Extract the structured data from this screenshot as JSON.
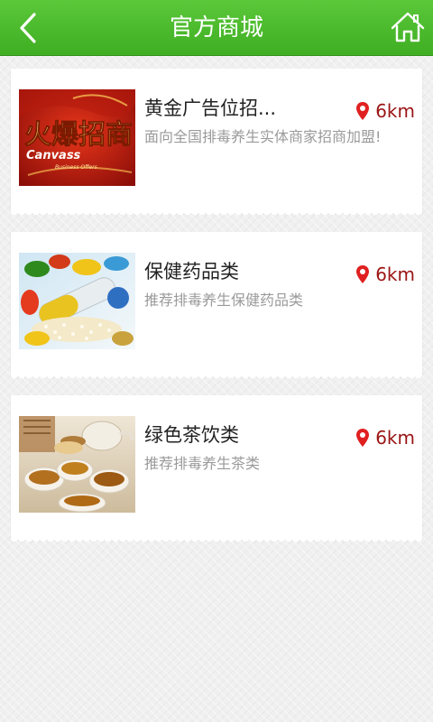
{
  "header": {
    "title": "官方商城",
    "back_icon": "chevron-left-icon",
    "home_icon": "home-icon"
  },
  "colors": {
    "header_green": "#43b02a",
    "distance_red": "#9b1414",
    "pin_red": "#e02020"
  },
  "items": [
    {
      "name": "黄金广告位招...",
      "description": "面向全国排毒养生实体商家招商加盟!",
      "distance": "6km",
      "thumb_logo_text": "火爆招商",
      "thumb_en_text": "Canvass",
      "thumb_en_sub": "Business Offers"
    },
    {
      "name": "保健药品类",
      "description": "推荐排毒养生保健药品类",
      "distance": "6km"
    },
    {
      "name": "绿色茶饮类",
      "description": "推荐排毒养生茶类",
      "distance": "6km"
    }
  ]
}
